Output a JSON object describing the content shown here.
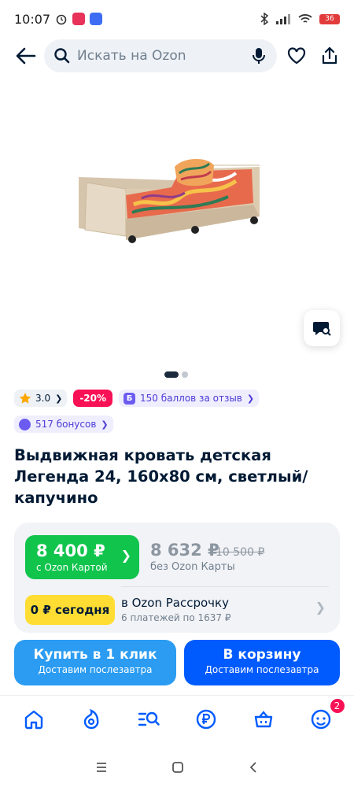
{
  "status_bar": {
    "time": "10:07",
    "battery": "36"
  },
  "search": {
    "placeholder": "Искать на Ozon"
  },
  "gallery": {
    "current_slide": 1,
    "slide_count": 2
  },
  "badges": {
    "rating": "3.0",
    "discount": "-20%",
    "review_points": "150 баллов за отзыв",
    "bonuses": "517 бонусов"
  },
  "product": {
    "title": "Выдвижная кровать детская Легенда 24, 160x80 см, светлый/капучино"
  },
  "price": {
    "card_price": "8 400 ₽",
    "card_label": "с Ozon Картой",
    "regular_price": "8 632 ₽",
    "old_price": "10 500 ₽",
    "regular_label": "без Ozon Карты",
    "today": "0 ₽ сегодня",
    "installment_title": "в Ozon Рассрочку",
    "installment_detail": "6 платежей по 1637 ₽"
  },
  "actions": {
    "buy_one_click": "Купить в 1 клик",
    "buy_one_click_sub": "Доставим послезавтра",
    "add_to_cart": "В корзину",
    "add_to_cart_sub": "Доставим послезавтра"
  },
  "nav": {
    "profile_badge": "2"
  },
  "colors": {
    "brand": "#005bff",
    "green": "#10c44c",
    "red": "#f91155",
    "yellow": "#ffdd33"
  }
}
